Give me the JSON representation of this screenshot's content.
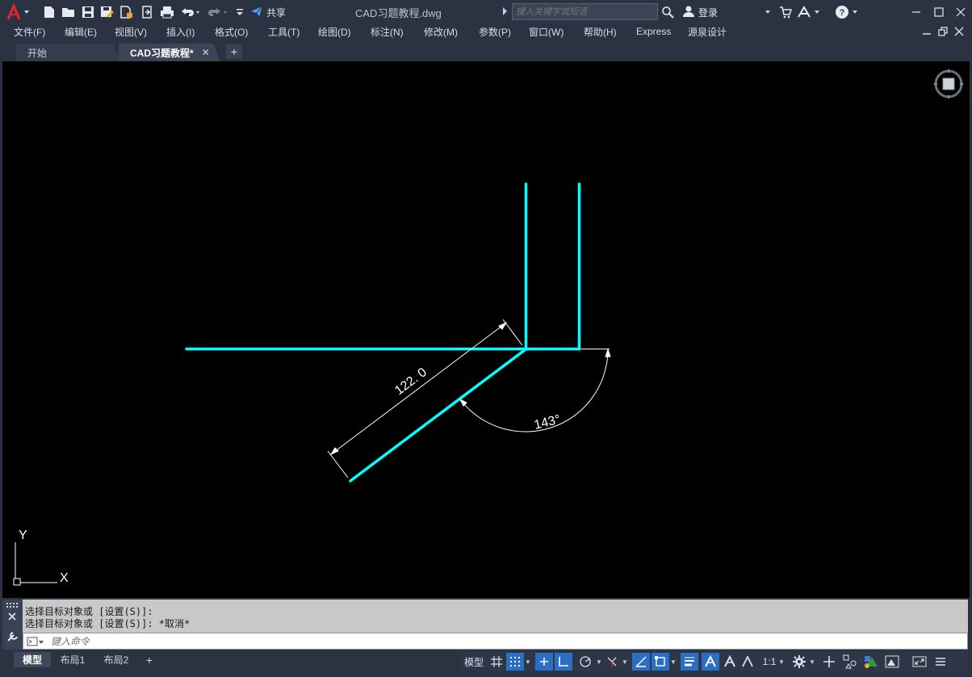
{
  "titlebar": {
    "document_title": "CAD习题教程.dwg",
    "share_label": "共享",
    "search_placeholder": "键入关键字或短语",
    "login_label": "登录",
    "icons": [
      "autocad-logo-icon",
      "new-icon",
      "open-icon",
      "save-icon",
      "save-as-icon",
      "open-web-icon",
      "publish-icon",
      "print-icon",
      "undo-icon",
      "redo-icon",
      "customize-icon",
      "share-icon",
      "search-icon",
      "user-icon",
      "cart-icon",
      "a360-icon",
      "help-icon"
    ]
  },
  "menubar": {
    "items": [
      "文件(F)",
      "编辑(E)",
      "视图(V)",
      "插入(I)",
      "格式(O)",
      "工具(T)",
      "绘图(D)",
      "标注(N)",
      "修改(M)",
      "参数(P)",
      "窗口(W)",
      "帮助(H)",
      "Express",
      "源泉设计"
    ]
  },
  "tabs": {
    "start_label": "开始",
    "active_label": "CAD习题教程*",
    "close_glyph": "✕",
    "add_glyph": "+"
  },
  "drawing": {
    "line_color": "#00ffff",
    "dimension_color": "#ffffff",
    "background": "#000000",
    "linear_dimension_text": "122. 0",
    "angular_dimension_text": "143°",
    "ucs_x_label": "X",
    "ucs_y_label": "Y"
  },
  "command": {
    "history": [
      "选择目标对象或 [设置(S)]:",
      "选择目标对象或 [设置(S)]: *取消*"
    ],
    "input_placeholder": "键入命令"
  },
  "statusbar": {
    "layouts": [
      "模型",
      "布局1",
      "布局2"
    ],
    "add_layout": "+",
    "model_label": "模型",
    "scale_label": "1:1"
  }
}
